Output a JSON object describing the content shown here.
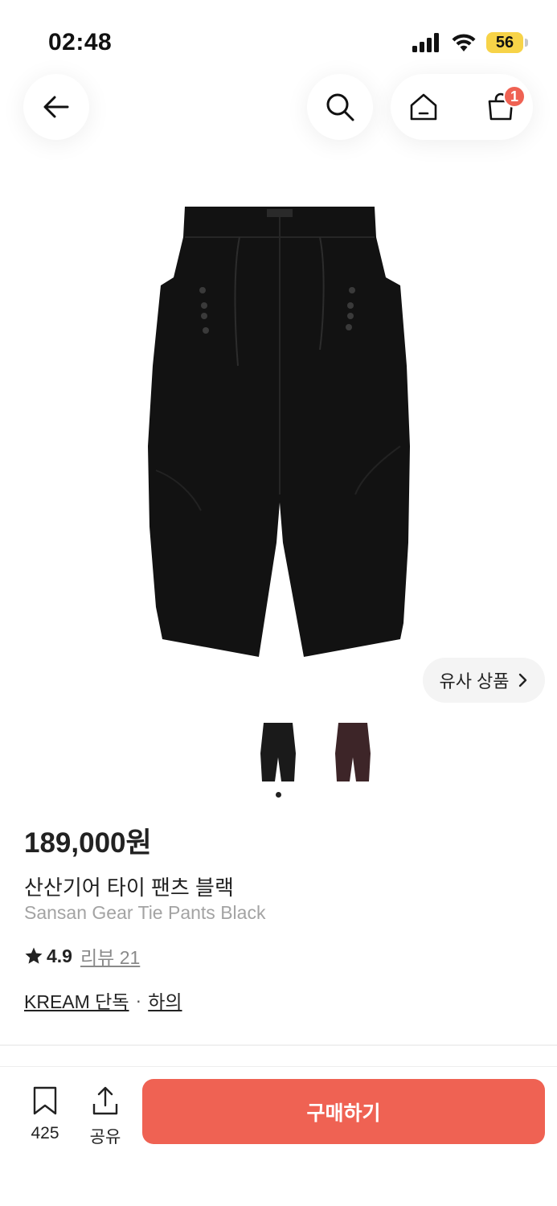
{
  "status_bar": {
    "time": "02:48",
    "battery": "56",
    "icons": [
      "cellular-signal-icon",
      "wifi-icon",
      "battery-icon"
    ]
  },
  "top_nav": {
    "icons": [
      "back-arrow-icon",
      "search-icon",
      "home-icon",
      "shopping-bag-icon"
    ],
    "cart_badge": "1"
  },
  "gallery": {
    "similar_button_label": "유사 상품",
    "similar_icon": "chevron-right-icon",
    "thumbnail_colors": [
      "#1a1a1a",
      "#3d2528"
    ],
    "selected_index": 0
  },
  "product": {
    "price": "189,000원",
    "name_ko": "산산기어 타이 팬츠 블랙",
    "name_en": "Sansan Gear Tie Pants Black",
    "rating": "4.9",
    "review_label": "리뷰 21",
    "tag_exclusive": "KREAM 단독",
    "separator": "·",
    "tag_category": "하의"
  },
  "bottom_bar": {
    "bookmark_count": "425",
    "share_label": "공유",
    "buy_label": "구매하기"
  },
  "colors": {
    "accent": "#ef6253",
    "badge_bg": "#f7d348",
    "muted_text": "#a3a3a3"
  }
}
